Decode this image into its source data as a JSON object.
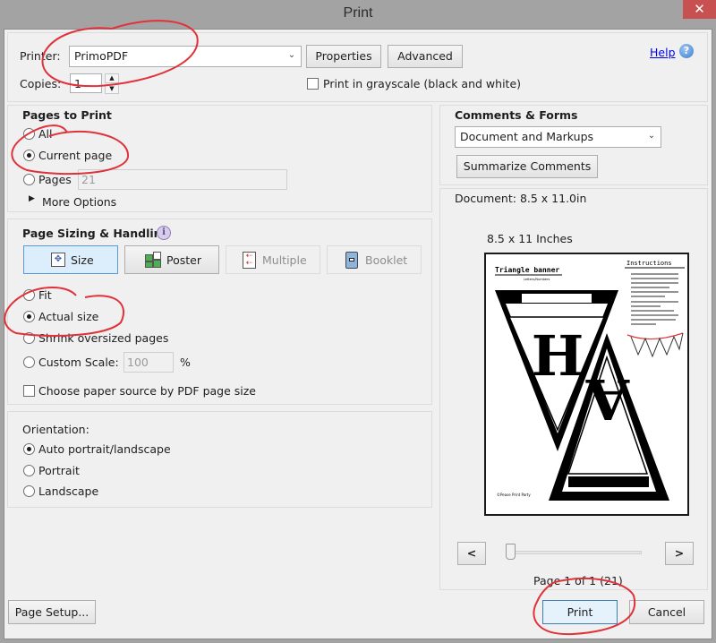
{
  "window": {
    "title": "Print",
    "close_glyph": "✕"
  },
  "printer": {
    "label": "Printer:",
    "selected": "PrimoPDF",
    "properties_label": "Properties",
    "advanced_label": "Advanced",
    "copies_label": "Copies:",
    "copies_value": "1",
    "grayscale_label": "Print in grayscale (black and white)",
    "grayscale_checked": false,
    "help_label": "Help",
    "help_icon": "question-circle-icon"
  },
  "pages_to_print": {
    "heading": "Pages to Print",
    "options": [
      {
        "label": "All",
        "checked": false
      },
      {
        "label": "Current page",
        "checked": true
      },
      {
        "label": "Pages",
        "checked": false
      }
    ],
    "pages_value": "21",
    "more_options_label": "More Options"
  },
  "page_sizing": {
    "heading": "Page Sizing & Handling",
    "modes": [
      {
        "label": "Size",
        "icon": "resize-page-icon",
        "state": "active"
      },
      {
        "label": "Poster",
        "icon": "poster-tiles-icon",
        "state": "normal"
      },
      {
        "label": "Multiple",
        "icon": "multiple-pages-icon",
        "state": "disabled"
      },
      {
        "label": "Booklet",
        "icon": "booklet-icon",
        "state": "disabled"
      }
    ],
    "options": [
      {
        "label": "Fit",
        "checked": false
      },
      {
        "label": "Actual size",
        "checked": true
      },
      {
        "label": "Shrink oversized pages",
        "checked": false
      },
      {
        "label": "Custom Scale:",
        "checked": false
      }
    ],
    "custom_scale_value": "100",
    "custom_scale_unit": "%",
    "paper_source_label": "Choose paper source by PDF page size",
    "paper_source_checked": false
  },
  "orientation": {
    "heading": "Orientation:",
    "options": [
      {
        "label": "Auto portrait/landscape",
        "checked": true
      },
      {
        "label": "Portrait",
        "checked": false
      },
      {
        "label": "Landscape",
        "checked": false
      }
    ]
  },
  "comments_forms": {
    "heading": "Comments & Forms",
    "selected": "Document and Markups",
    "summarize_label": "Summarize Comments"
  },
  "preview": {
    "document_size": "Document: 8.5 x 11.0in",
    "page_size": "8.5 x 11 Inches",
    "page_content": {
      "title": "Triangle banner",
      "subtitle": "Letters/Numbers",
      "instructions_heading": "Instructions",
      "letter_1": "H",
      "letter_2": "A",
      "footer": "©Pease Print Party"
    },
    "prev_label": "<",
    "next_label": ">",
    "page_indicator": "Page 1 of 1 (21)",
    "slider_position": 0
  },
  "footer": {
    "page_setup_label": "Page Setup...",
    "print_label": "Print",
    "cancel_label": "Cancel"
  },
  "annotation_color": "#e0323a"
}
